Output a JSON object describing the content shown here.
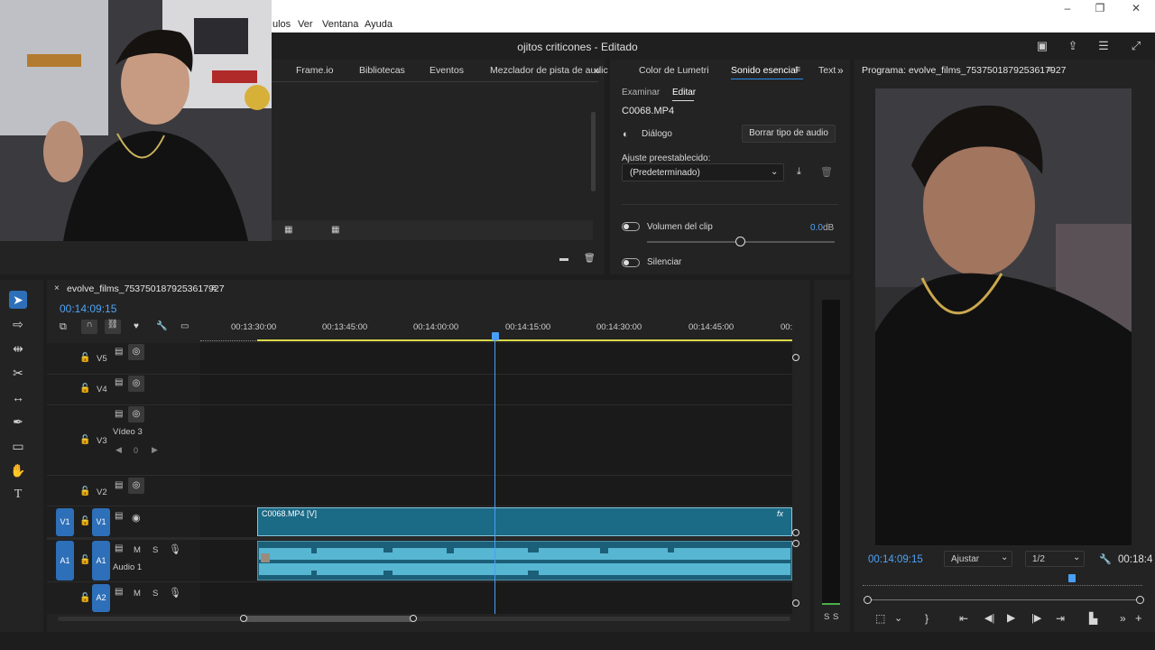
{
  "window": {
    "title": "ojitos criticones - Editado",
    "menu": [
      "ulos",
      "Ver",
      "Ventana",
      "Ayuda"
    ]
  },
  "top_tabs": [
    "Frame.io",
    "Bibliotecas",
    "Eventos",
    "Mezclador de pista de audic"
  ],
  "essential": {
    "tabs": [
      "Color de Lumetri",
      "Sonido esencial",
      "Text"
    ],
    "subtabs": [
      "Examinar",
      "Editar"
    ],
    "clip_name": "C0068.MP4",
    "type_label": "Diálogo",
    "clear_button": "Borrar tipo de audio",
    "preset_label": "Ajuste preestablecido:",
    "preset_value": "(Predeterminado)",
    "clip_volume_label": "Volumen del clip",
    "clip_volume_value": "0.0",
    "clip_volume_unit": "dB",
    "mute_label": "Silenciar"
  },
  "program": {
    "title": "Programa: evolve_films_7537501879253617927",
    "timecode": "00:14:09:15",
    "fit": "Ajustar",
    "resolution": "1/2",
    "duration": "00:18:4"
  },
  "timeline": {
    "sequence_tab": "evolve_films_7537501879253617927",
    "timecode": "00:14:09:15",
    "ruler": [
      "00:13:30:00",
      "00:13:45:00",
      "00:14:00:00",
      "00:14:15:00",
      "00:14:30:00",
      "00:14:45:00",
      "00:"
    ],
    "tracks": {
      "v5": "V5",
      "v4": "V4",
      "v3": "V3",
      "v3_name": "Vídeo 3",
      "v3_value": "0",
      "v2": "V2",
      "v1": "V1",
      "v1_src": "V1",
      "a1": "A1",
      "a1_src": "A1",
      "a1_name": "Audio 1",
      "a2": "A2",
      "m": "M",
      "s": "S"
    },
    "video_clip": "C0068.MP4 [V]",
    "fx": "fx"
  },
  "meter": {
    "s1": "S",
    "s2": "S"
  },
  "colors": {
    "accent": "#2d8ceb",
    "clip_video": "#1b6a86",
    "clip_audio": "#5fc1dc",
    "playhead": "#4a9ff5"
  }
}
